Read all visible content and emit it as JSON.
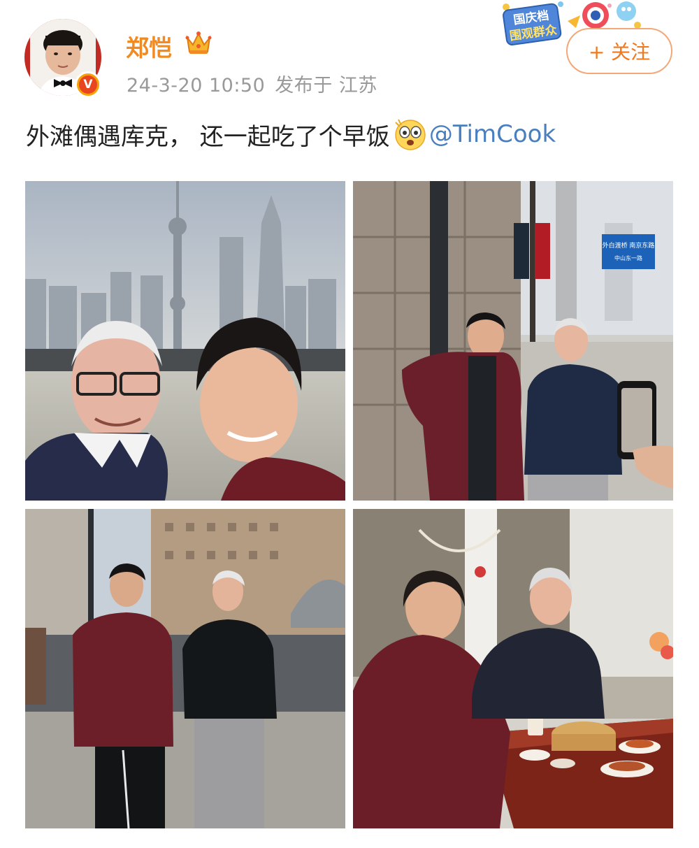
{
  "post": {
    "username": "郑恺",
    "timestamp": "24-3-20 10:50",
    "location_prefix": "发布于",
    "location": "江苏",
    "follow_button": "+ 关注",
    "text_body": "外滩偶遇库克， 还一起吃了个早饭",
    "mention": "@TimCook",
    "badges": {
      "verified": "V",
      "event_line1": "国庆档",
      "event_line2": "围观群众"
    }
  },
  "photos": {
    "sign_text_line1": "外白渡桥  南京东路",
    "sign_text_line2": "中山东一路"
  },
  "colors": {
    "username": "#f08a22",
    "mention": "#4a7fbf",
    "follow_border": "#f3a877",
    "follow_text": "#f3781d",
    "meta": "#999999"
  },
  "icons": [
    "avatar",
    "verified-badge-icon",
    "crown-icon",
    "event-badge-icon",
    "plus-icon",
    "emoji-icon"
  ]
}
